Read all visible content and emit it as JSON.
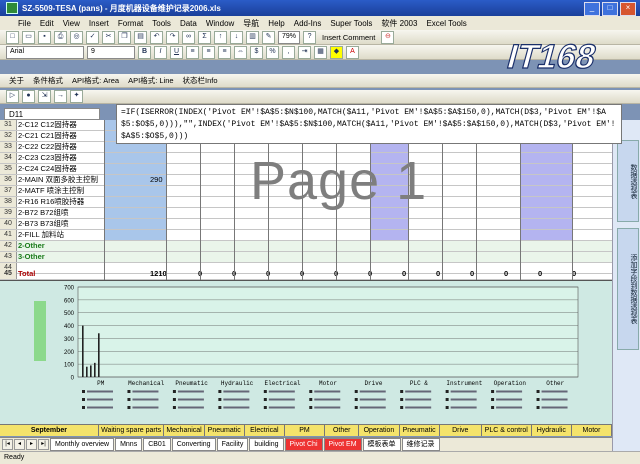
{
  "window": {
    "title": "SZ-5509-TESA (pans) - 月度机器设备维护记录2006.xls"
  },
  "menu": [
    "File",
    "Edit",
    "View",
    "Insert",
    "Format",
    "Tools",
    "Data",
    "Window",
    "导航",
    "Help",
    "Add-Ins",
    "Super Tools",
    "软件 2003",
    "Excel Tools"
  ],
  "toolbar": {
    "zoom": "79%",
    "insert_comment": "Insert Comment",
    "font": "Arial",
    "font_size": "9",
    "row3": [
      "关于",
      "条件格式",
      "API格式: Area",
      "API格式: Line",
      "状态栏Info"
    ]
  },
  "logo": {
    "text": "IT168"
  },
  "formula_bar": {
    "name_box": "D11",
    "formula": "=IF(ISERROR(INDEX('Pivot EM'!$A$5:$N$100,MATCH($A11,'Pivot EM'!$A$5:$A$150,0),MATCH(D$3,'Pivot EM'!$A$5:$O$5,0))),\"\",INDEX('Pivot EM'!$A$5:$N$100,MATCH($A11,'Pivot EM'!$A$5:$A$150,0),MATCH(D$3,'Pivot EM'!$A$5:$O$5,0)))"
  },
  "rows": [
    {
      "num": "31",
      "label": "2-C12   C12固持器"
    },
    {
      "num": "32",
      "label": "2-C21   C21固持器"
    },
    {
      "num": "33",
      "label": "2-C22   C22固持器"
    },
    {
      "num": "34",
      "label": "2-C23   C23固持器"
    },
    {
      "num": "35",
      "label": "2-C24   C24固持器"
    },
    {
      "num": "36",
      "label": "2-MAIN   双面多胶主控制",
      "value": "290"
    },
    {
      "num": "37",
      "label": "2-MATF   喷涂主控制"
    },
    {
      "num": "38",
      "label": "2-R16    R16喷胶持器"
    },
    {
      "num": "39",
      "label": "2-B72    B72组喷"
    },
    {
      "num": "40",
      "label": "2-B73    B73组喷"
    },
    {
      "num": "41",
      "label": "2-FILL   加料站"
    },
    {
      "num": "42",
      "label": "2-Other"
    },
    {
      "num": "43",
      "label": "3-Other"
    },
    {
      "num": "44",
      "label": ""
    },
    {
      "num": "45",
      "label": "Total",
      "value": "1210",
      "zeros": [
        "0",
        "0",
        "0",
        "0",
        "0",
        "0",
        "0",
        "0",
        "0",
        "0",
        "0",
        "0"
      ]
    }
  ],
  "watermark": "Page 1",
  "chart_data": {
    "type": "bar",
    "ylabel": "",
    "ylim": [
      0,
      700
    ],
    "yticks": [
      "700",
      "600",
      "500",
      "400",
      "300",
      "200",
      "100",
      "0"
    ],
    "categories": [
      "PM",
      "Mechanical",
      "Pneumatic",
      "Hydraulic",
      "Electrical",
      "Motor",
      "Drive",
      "PLC &",
      "Instrument",
      "Operation",
      "Other"
    ],
    "values": [
      400,
      80,
      90,
      110,
      340,
      0,
      0,
      0,
      0,
      0,
      0,
      0,
      0
    ]
  },
  "bottom_header": [
    "September",
    "Waiting spare parts",
    "Mechanical",
    "Pneumatic",
    "Electrical",
    "PM",
    "Other",
    "Operation",
    "Pneumatic",
    "Drive",
    "PLC & control",
    "Hydraulic",
    "Motor"
  ],
  "sheet_tabs": [
    "Monthly overview",
    "Mnns",
    "CB01",
    "Converting",
    "Facility",
    "building",
    "Pivot Chi",
    "Pivot EM",
    "模板表单",
    "维修记录"
  ],
  "status": "Ready",
  "task_pane": [
    "数据透视表",
    "添加字段到数据透视表"
  ]
}
